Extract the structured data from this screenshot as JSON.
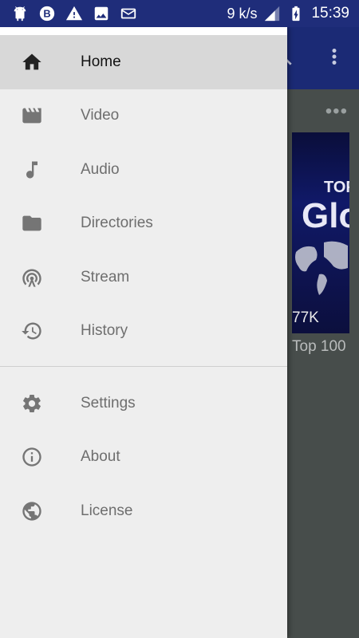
{
  "status_bar": {
    "speed": "9 k/s",
    "time": "15:39",
    "icons": [
      "android-icon",
      "b-badge-icon",
      "warning-icon",
      "image-icon",
      "mail-icon",
      "signal-icon",
      "battery-charging-icon"
    ]
  },
  "background": {
    "thumbnail": {
      "overlay_line1": "TOP",
      "overlay_line2": "Glo",
      "views": "77K",
      "title": "Top 100"
    },
    "more_indicator": "•••"
  },
  "drawer": {
    "primary_items": [
      {
        "label": "Home",
        "icon": "home-icon",
        "active": true
      },
      {
        "label": "Video",
        "icon": "video-clapper-icon",
        "active": false
      },
      {
        "label": "Audio",
        "icon": "music-note-icon",
        "active": false
      },
      {
        "label": "Directories",
        "icon": "folder-icon",
        "active": false
      },
      {
        "label": "Stream",
        "icon": "stream-antenna-icon",
        "active": false
      },
      {
        "label": "History",
        "icon": "history-icon",
        "active": false
      }
    ],
    "secondary_items": [
      {
        "label": "Settings",
        "icon": "gear-icon"
      },
      {
        "label": "About",
        "icon": "info-icon"
      },
      {
        "label": "License",
        "icon": "globe-icon"
      }
    ]
  },
  "colors": {
    "status_bar": "#1f2d7a",
    "app_bar": "#1b2a75",
    "drawer_bg": "#eeeeee",
    "active_item_bg": "#d8d8d8"
  }
}
